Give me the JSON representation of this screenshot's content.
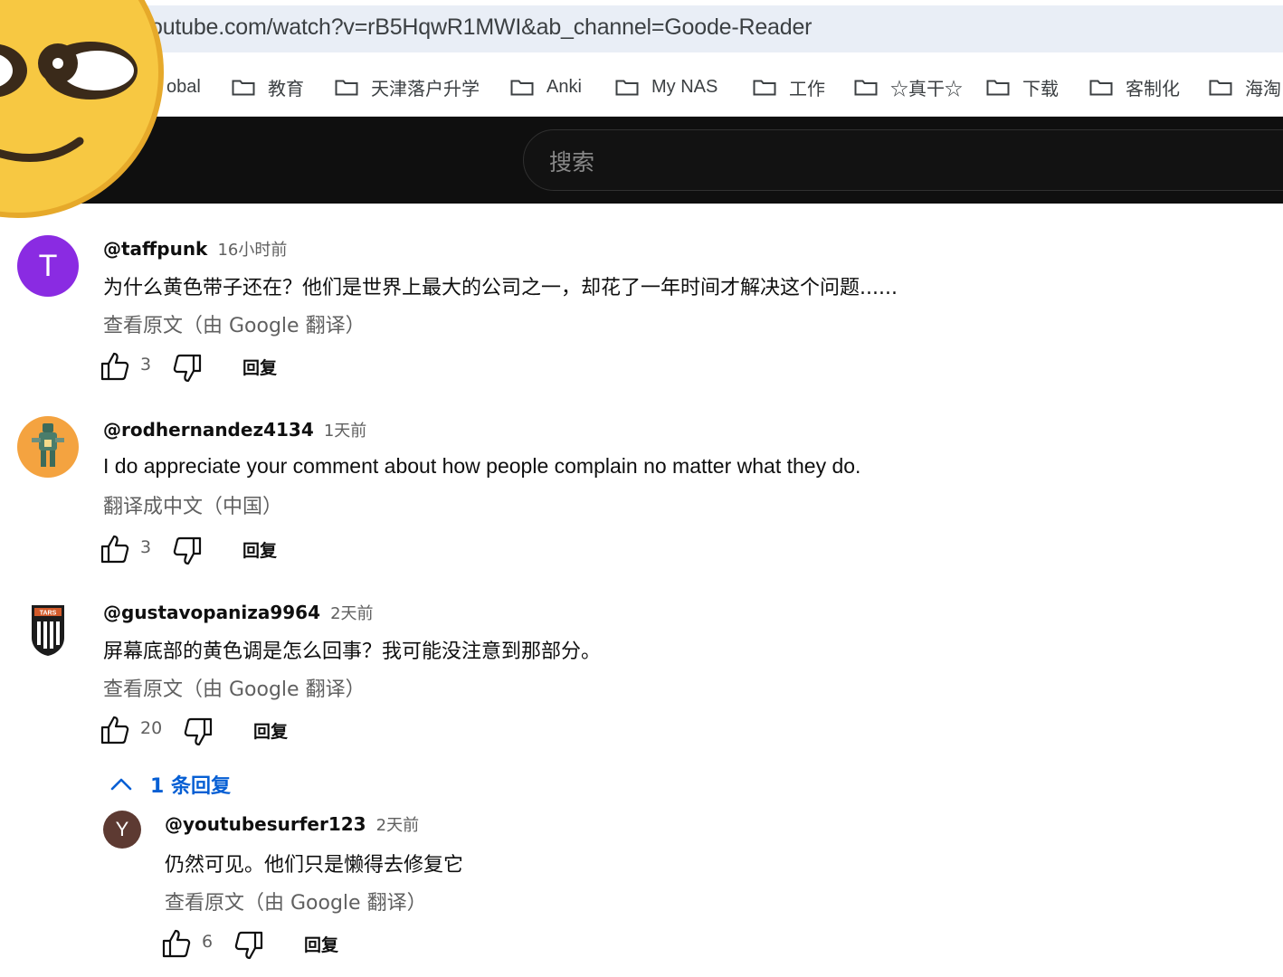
{
  "browser": {
    "url": "outube.com/watch?v=rB5HqwR1MWI&ab_channel=Goode-Reader",
    "bookmarks": [
      {
        "label": "obal"
      },
      {
        "label": "教育"
      },
      {
        "label": "天津落户升学"
      },
      {
        "label": "Anki"
      },
      {
        "label": "My NAS"
      },
      {
        "label": "工作"
      },
      {
        "label": "☆真干☆"
      },
      {
        "label": "下载"
      },
      {
        "label": "客制化"
      },
      {
        "label": "海淘"
      }
    ]
  },
  "masthead": {
    "search_placeholder": "搜索"
  },
  "comments": [
    {
      "avatar_letter": "T",
      "avatar_color": "#8a2be2",
      "author": "@taffpunk",
      "time": "16小时前",
      "text": "为什么黄色带子还在？他们是世界上最大的公司之一，却花了一年时间才解决这个问题......",
      "translate_label": "查看原文（由 Google 翻译）",
      "likes": "3",
      "reply_label": "回复"
    },
    {
      "avatar_letter": "",
      "avatar_color": "#f4a340",
      "author": "@rodhernandez4134",
      "time": "1天前",
      "text": "I do appreciate your comment about how people complain no matter what they do.",
      "translate_label": "翻译成中文（中国）",
      "likes": "3",
      "reply_label": "回复"
    },
    {
      "avatar_letter": "",
      "avatar_color": "#ffffff",
      "avatar_badge": "TARS",
      "author": "@gustavopaniza9964",
      "time": "2天前",
      "text": "屏幕底部的黄色调是怎么回事？我可能没注意到那部分。",
      "translate_label": "查看原文（由 Google 翻译）",
      "likes": "20",
      "reply_label": "回复"
    }
  ],
  "replies_toggle": {
    "label": "1 条回复"
  },
  "reply": {
    "avatar_letter": "Y",
    "avatar_color": "#5d3a32",
    "author": "@youtubesurfer123",
    "time": "2天前",
    "text": "仍然可见。他们只是懒得去修复它",
    "translate_label": "查看原文（由 Google 翻译）",
    "likes": "6",
    "reply_label": "回复"
  },
  "colors": {
    "link_blue": "#065fd4",
    "masthead_bg": "#0f0f0f",
    "emoji_yellow": "#f7c842"
  }
}
